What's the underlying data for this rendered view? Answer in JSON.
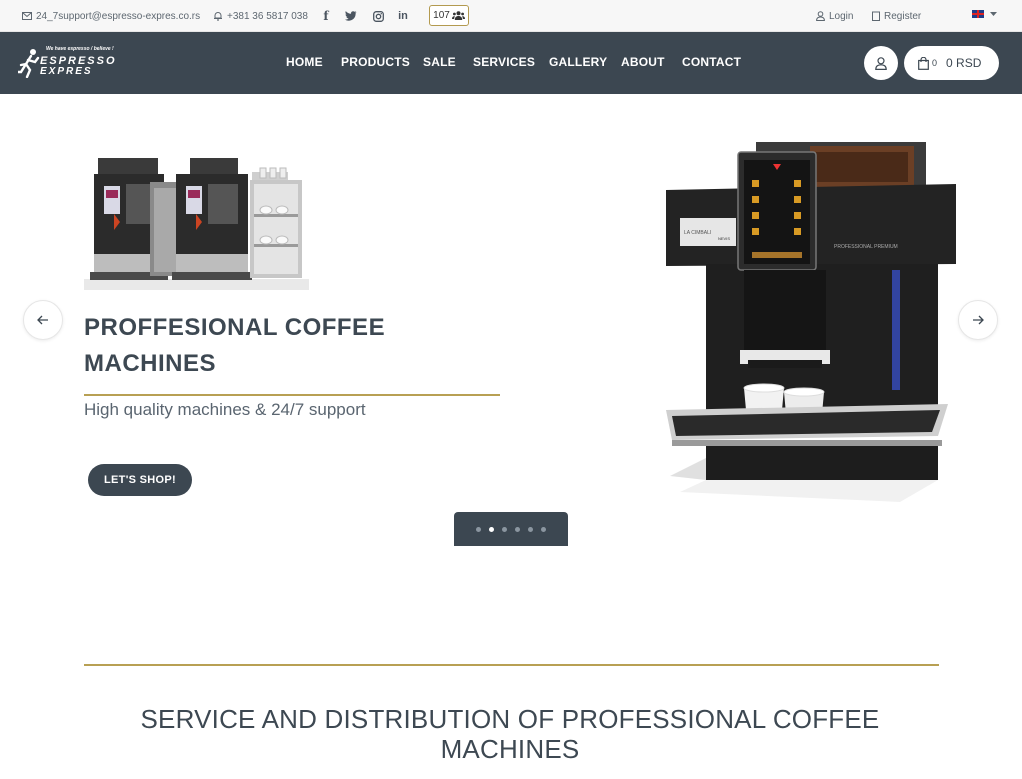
{
  "topbar": {
    "email": "24_7support@espresso-expres.co.rs",
    "phone": "+381 36 5817 038",
    "social": [
      {
        "name": "facebook-icon",
        "glyph": "f"
      },
      {
        "name": "twitter-icon",
        "glyph": "t"
      },
      {
        "name": "instagram-icon",
        "glyph": "i"
      },
      {
        "name": "linkedin-icon",
        "glyph": "in"
      }
    ],
    "visitors": "107",
    "login": "Login",
    "register": "Register",
    "language": "EN"
  },
  "logo": {
    "tagline": "We have espresso / believe !",
    "line1": "ESPRESSO",
    "line2": "EXPRES"
  },
  "nav": {
    "items": [
      "HOME",
      "PRODUCTS",
      "SALE",
      "SERVICES",
      "GALLERY",
      "ABOUT",
      "CONTACT"
    ],
    "cart_count": "0",
    "cart_total": "0 RSD"
  },
  "hero": {
    "title": "PROFFESIONAL COFFEE MACHINES",
    "subtitle": "High quality machines & 24/7 support",
    "button": "LET'S SHOP!",
    "slide_count": 6,
    "active_slide": 2,
    "machine_panel_label": "PROFESSIONAL PREMIUM",
    "machine_badge": "NEVIS"
  },
  "section": {
    "title": "SERVICE AND DISTRIBUTION OF PROFESSIONAL COFFEE MACHINES"
  },
  "colors": {
    "navbar": "#3c4751",
    "accent_gold": "#b8a053",
    "topbar": "#f7f7f7"
  }
}
